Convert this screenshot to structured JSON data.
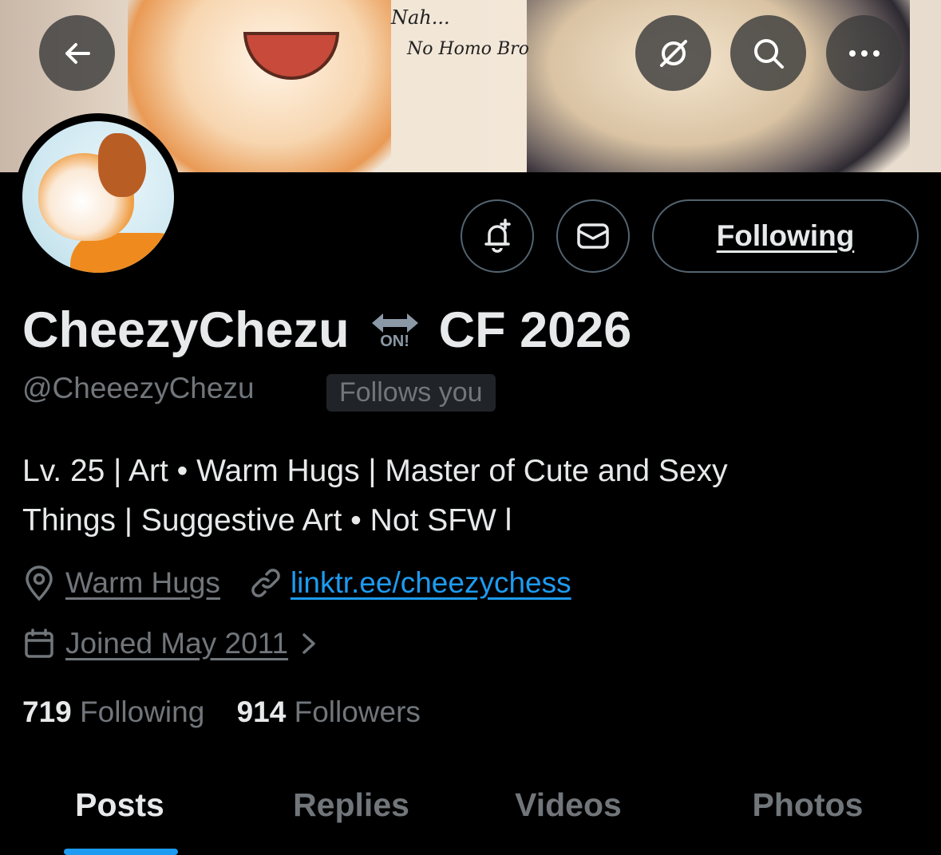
{
  "banner": {
    "speech_line1": "Nah...",
    "speech_line2": "No Homo Bro"
  },
  "header_buttons": {
    "back_icon": "arrow-left-icon",
    "grok_icon": "grok-icon",
    "search_icon": "search-icon",
    "more_icon": "more-icon"
  },
  "actions": {
    "notify_icon": "bell-plus-icon",
    "message_icon": "envelope-icon",
    "following_label": "Following"
  },
  "profile": {
    "name_part1": "CheezyChezu",
    "name_badge_text": "ON!",
    "name_part2": "CF 2026",
    "handle": "@CheeezyChezu",
    "follows_you": "Follows you",
    "bio_line1": "Lv. 25 | Art • Warm Hugs | Master of Cute and Sexy",
    "bio_line2": "Things | Suggestive Art • Not SFW l",
    "location": "Warm Hugs",
    "website": "linktr.ee/cheezychess",
    "joined": "Joined May 2011",
    "following_count": "719",
    "following_label": "Following",
    "followers_count": "914",
    "followers_label": "Followers"
  },
  "tabs": [
    {
      "label": "Posts",
      "active": true
    },
    {
      "label": "Replies",
      "active": false
    },
    {
      "label": "Videos",
      "active": false
    },
    {
      "label": "Photos",
      "active": false
    }
  ],
  "colors": {
    "background": "#000000",
    "text_primary": "#e7e9ea",
    "text_secondary": "#71767b",
    "accent": "#1d9bf0",
    "border": "#536471"
  }
}
